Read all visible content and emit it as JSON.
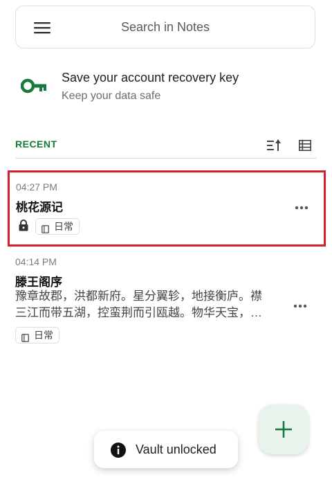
{
  "search": {
    "placeholder": "Search in Notes"
  },
  "recovery_banner": {
    "title": "Save your account recovery key",
    "subtitle": "Keep your data safe"
  },
  "recent": {
    "label": "RECENT"
  },
  "notes": [
    {
      "time": "04:27 PM",
      "title": "桃花源记",
      "tag": "日常",
      "locked": true
    },
    {
      "time": "04:14 PM",
      "title": "滕王阁序",
      "preview_line1": "豫章故郡，洪都新府。星分翼轸，地接衡庐。襟",
      "preview_line2": "三江而带五湖，控蛮荆而引瓯越。物华天宝，…",
      "tag": "日常",
      "locked": false
    }
  ],
  "toast": {
    "text": "Vault unlocked"
  },
  "colors": {
    "accent": "#137a3c",
    "selection": "#d4202e",
    "fab_bg": "#e7f3eb"
  },
  "icons": {
    "menu": "menu-icon",
    "key": "key-icon",
    "sort": "sort-icon",
    "view": "list-view-icon",
    "lock": "lock-icon",
    "tag": "book-icon",
    "more": "more-horizontal-icon",
    "fab": "plus-icon",
    "toast": "info-icon"
  }
}
